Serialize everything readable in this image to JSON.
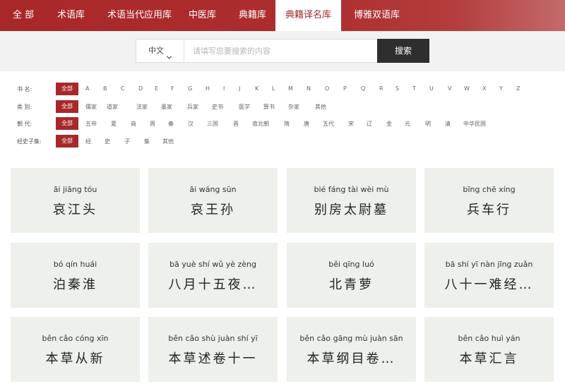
{
  "nav": {
    "items": [
      {
        "label": "全 部"
      },
      {
        "label": "术语库"
      },
      {
        "label": "术语当代应用库"
      },
      {
        "label": "中医库"
      },
      {
        "label": "典籍库"
      },
      {
        "label": "典籍译名库",
        "active": true
      },
      {
        "label": "博雅双语库"
      }
    ],
    "active_color": "#a8282a"
  },
  "search": {
    "scope_label": "中文",
    "placeholder": "请填写您要搜索的内容",
    "button_label": "搜索"
  },
  "filters": {
    "book_name": {
      "label": "书 名:",
      "options": [
        "全部",
        "A",
        "B",
        "C",
        "D",
        "E",
        "F",
        "G",
        "H",
        "I",
        "J",
        "K",
        "L",
        "M",
        "N",
        "O",
        "P",
        "Q",
        "R",
        "S",
        "T",
        "U",
        "V",
        "W",
        "X",
        "Y",
        "Z"
      ]
    },
    "category": {
      "label": "类 别:",
      "options": [
        "全部",
        "儒家",
        "道家",
        "法家",
        "墨家",
        "兵家",
        "史书",
        "医学",
        "算书",
        "杂家",
        "其他"
      ]
    },
    "dynasty": {
      "label": "朝 代:",
      "options": [
        "全部",
        "五帝",
        "夏",
        "商",
        "周",
        "秦",
        "汉",
        "三国",
        "晋",
        "南北朝",
        "隋",
        "唐",
        "五代",
        "宋",
        "辽",
        "金",
        "元",
        "明",
        "清",
        "中华民国"
      ]
    },
    "sibu": {
      "label": "经史子集:",
      "options": [
        "全部",
        "经",
        "史",
        "子",
        "集",
        "其他"
      ]
    },
    "selected_color": "#a8282a"
  },
  "cards": [
    {
      "pinyin": "āi jiāng tóu",
      "title": "哀江头"
    },
    {
      "pinyin": "āi wáng sūn",
      "title": "哀王孙"
    },
    {
      "pinyin": "bié fáng tài wèi mù",
      "title": "别房太尉墓"
    },
    {
      "pinyin": "bīng chē xíng",
      "title": "兵车行"
    },
    {
      "pinyin": "bó qín huái",
      "title": "泊秦淮"
    },
    {
      "pinyin": "bā yuè shí wǔ yè zèng",
      "title": "八月十五夜…"
    },
    {
      "pinyin": "běi qīng luó",
      "title": "北青萝"
    },
    {
      "pinyin": "bā shí yī nàn jīng zuǎn",
      "title": "八十一难经…"
    },
    {
      "pinyin": "běn cǎo cóng xīn",
      "title": "本草从新"
    },
    {
      "pinyin": "běn cǎo shù juàn shí yī",
      "title": "本草述卷十一"
    },
    {
      "pinyin": "běn cǎo gāng mù juàn sān",
      "title": "本草纲目卷…"
    },
    {
      "pinyin": "běn cǎo huì yán",
      "title": "本草汇言"
    }
  ]
}
